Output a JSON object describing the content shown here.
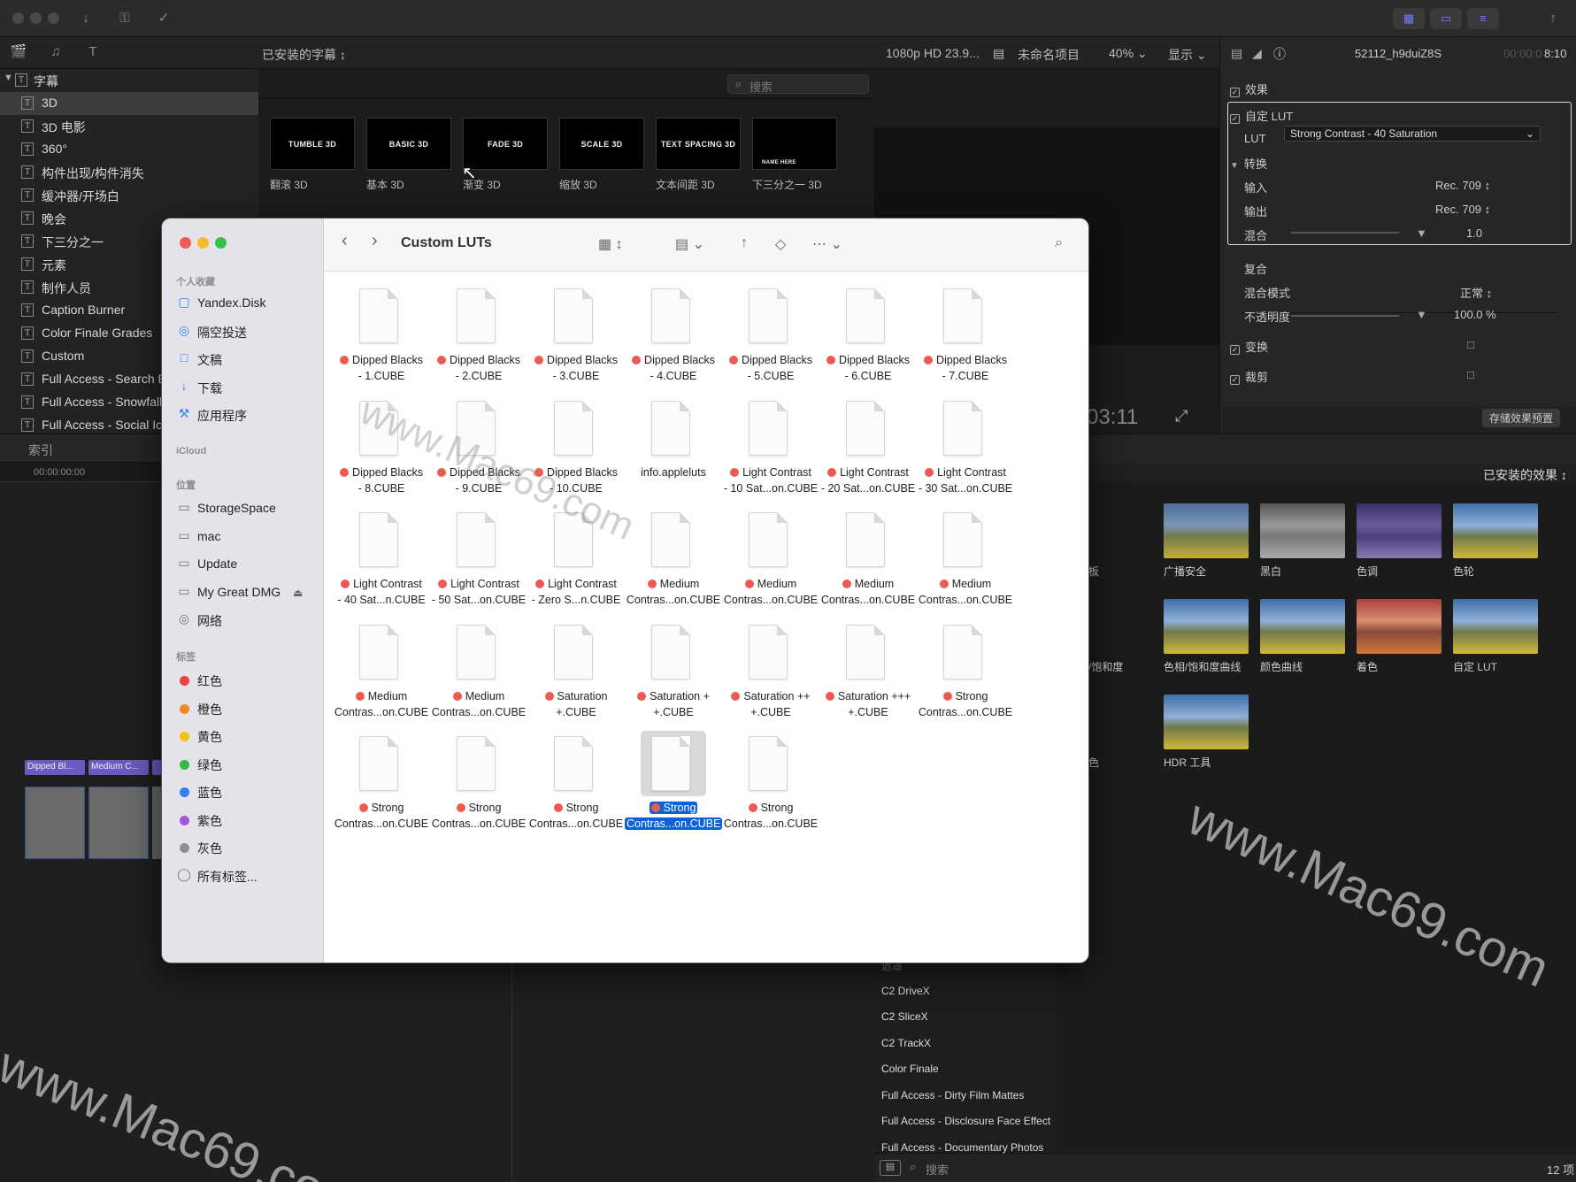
{
  "toolbar": {
    "icons": [
      "download-icon",
      "key-icon",
      "check-circle-icon"
    ]
  },
  "browser": {
    "title": "已安装的字幕",
    "search_placeholder": "搜索",
    "thumbs": [
      {
        "art": "TUMBLE 3D",
        "label": "翻滚 3D"
      },
      {
        "art": "BASIC 3D",
        "label": "基本 3D"
      },
      {
        "art": "FADE 3D",
        "label": "渐变 3D"
      },
      {
        "art": "SCALE 3D",
        "label": "缩放 3D"
      },
      {
        "art": "TEXT SPACING 3D",
        "label": "文本间距 3D"
      },
      {
        "art": "NAME HERE",
        "label": "下三分之一 3D"
      }
    ]
  },
  "viewer": {
    "format": "1080p HD 23.9...",
    "project": "未命名项目",
    "zoom": "40%",
    "display": "显示",
    "timecode": "03:11"
  },
  "sidebar": {
    "root": "字幕",
    "items": [
      "3D",
      "3D 电影",
      "360°",
      "构件出现/构件消失",
      "缓冲器/开场白",
      "晚会",
      "下三分之一",
      "元素",
      "制作人员",
      "Caption Burner",
      "Color Finale Grades",
      "Custom",
      "Full Access - Search E",
      "Full Access - Snowfall",
      "Full Access - Social Ico"
    ]
  },
  "inspector": {
    "clip_name": "52112_h9duiZ8S",
    "duration": "8:10",
    "timecode_prefix": "00:00:0",
    "effects": "效果",
    "custom_lut": "自定 LUT",
    "lut_label": "LUT",
    "lut_value": "Strong Contrast - 40 Saturation",
    "convert": "转换",
    "input_label": "输入",
    "input_value": "Rec. 709",
    "output_label": "输出",
    "output_value": "Rec. 709",
    "mix_label": "混合",
    "mix_value": "1.0",
    "composite": "复合",
    "blend_mode_label": "混合模式",
    "blend_mode_value": "正常",
    "opacity_label": "不透明度",
    "opacity_value": "100.0",
    "opacity_unit": "%",
    "transform": "变换",
    "crop": "裁剪",
    "save_preset": "存储效果预置"
  },
  "timeline": {
    "index_tab": "索引",
    "timecode": "00:00:00:00",
    "clip1": "Dipped Bl...",
    "clip2": "Medium C..."
  },
  "effects": {
    "title": "已安装的效果",
    "count": "12 项",
    "search_placeholder": "搜索",
    "row1": [
      "板",
      "广播安全",
      "黑白",
      "色调",
      "色轮"
    ],
    "row2": [
      "/饱和度",
      "色相/饱和度曲线",
      "颜色曲线",
      "着色",
      "自定 LUT"
    ],
    "row3": [
      "色",
      "HDR 工具"
    ],
    "categories": [
      "遮罩",
      "C2 DriveX",
      "C2 SliceX",
      "C2 TrackX",
      "Color Finale",
      "Full Access - Dirty Film Mattes",
      "Full Access - Disclosure Face Effect",
      "Full Access - Documentary Photos"
    ]
  },
  "finder": {
    "title": "Custom LUTs",
    "sections": {
      "favorites": "个人收藏",
      "icloud": "iCloud",
      "locations": "位置",
      "tags": "标签"
    },
    "favorites": [
      {
        "icon": "cloud-folder-icon",
        "label": "Yandex.Disk"
      },
      {
        "icon": "airdrop-icon",
        "label": "隔空投送"
      },
      {
        "icon": "document-icon",
        "label": "文稿"
      },
      {
        "icon": "download-icon",
        "label": "下载"
      },
      {
        "icon": "applications-icon",
        "label": "应用程序"
      }
    ],
    "locations": [
      {
        "icon": "disk-icon",
        "label": "StorageSpace"
      },
      {
        "icon": "disk-icon",
        "label": "mac"
      },
      {
        "icon": "disk-icon",
        "label": "Update"
      },
      {
        "icon": "disk-icon",
        "label": "My Great DMG"
      },
      {
        "icon": "network-icon",
        "label": "网络"
      }
    ],
    "tags": [
      {
        "label": "红色",
        "color": "#e8453c"
      },
      {
        "label": "橙色",
        "color": "#f08c1e"
      },
      {
        "label": "黄色",
        "color": "#f2c216"
      },
      {
        "label": "绿色",
        "color": "#33b84a"
      },
      {
        "label": "蓝色",
        "color": "#2f7ff5"
      },
      {
        "label": "紫色",
        "color": "#a257d6"
      },
      {
        "label": "灰色",
        "color": "#8e8e93"
      }
    ],
    "all_tags": "所有标签...",
    "files": [
      {
        "l1": "Dipped Blacks",
        "l2": "- 1.CUBE",
        "tag": true
      },
      {
        "l1": "Dipped Blacks",
        "l2": "- 2.CUBE",
        "tag": true
      },
      {
        "l1": "Dipped Blacks",
        "l2": "- 3.CUBE",
        "tag": true
      },
      {
        "l1": "Dipped Blacks",
        "l2": "- 4.CUBE",
        "tag": true
      },
      {
        "l1": "Dipped Blacks",
        "l2": "- 5.CUBE",
        "tag": true
      },
      {
        "l1": "Dipped Blacks",
        "l2": "- 6.CUBE",
        "tag": true
      },
      {
        "l1": "Dipped Blacks",
        "l2": "- 7.CUBE",
        "tag": true
      },
      {
        "l1": "Dipped Blacks",
        "l2": "- 8.CUBE",
        "tag": true
      },
      {
        "l1": "Dipped Blacks",
        "l2": "- 9.CUBE",
        "tag": true
      },
      {
        "l1": "Dipped Blacks",
        "l2": "- 10.CUBE",
        "tag": true
      },
      {
        "l1": "info.appleluts",
        "l2": "",
        "tag": false
      },
      {
        "l1": "Light Contrast",
        "l2": "- 10 Sat...on.CUBE",
        "tag": true
      },
      {
        "l1": "Light Contrast",
        "l2": "- 20 Sat...on.CUBE",
        "tag": true
      },
      {
        "l1": "Light Contrast",
        "l2": "- 30 Sat...on.CUBE",
        "tag": true
      },
      {
        "l1": "Light Contrast",
        "l2": "- 40 Sat...n.CUBE",
        "tag": true
      },
      {
        "l1": "Light Contrast",
        "l2": "- 50 Sat...on.CUBE",
        "tag": true
      },
      {
        "l1": "Light Contrast",
        "l2": "- Zero S...n.CUBE",
        "tag": true
      },
      {
        "l1": "Medium",
        "l2": "Contras...on.CUBE",
        "tag": true
      },
      {
        "l1": "Medium",
        "l2": "Contras...on.CUBE",
        "tag": true
      },
      {
        "l1": "Medium",
        "l2": "Contras...on.CUBE",
        "tag": true
      },
      {
        "l1": "Medium",
        "l2": "Contras...on.CUBE",
        "tag": true
      },
      {
        "l1": "Medium",
        "l2": "Contras...on.CUBE",
        "tag": true
      },
      {
        "l1": "Medium",
        "l2": "Contras...on.CUBE",
        "tag": true
      },
      {
        "l1": "Saturation",
        "l2": "+.CUBE",
        "tag": true
      },
      {
        "l1": "Saturation +",
        "l2": "+.CUBE",
        "tag": true
      },
      {
        "l1": "Saturation ++",
        "l2": "+.CUBE",
        "tag": true
      },
      {
        "l1": "Saturation +++",
        "l2": "+.CUBE",
        "tag": true
      },
      {
        "l1": "Strong",
        "l2": "Contras...on.CUBE",
        "tag": true
      },
      {
        "l1": "Strong",
        "l2": "Contras...on.CUBE",
        "tag": true
      },
      {
        "l1": "Strong",
        "l2": "Contras...on.CUBE",
        "tag": true
      },
      {
        "l1": "Strong",
        "l2": "Contras...on.CUBE",
        "tag": true
      },
      {
        "l1": "Strong",
        "l2": "Contras...on.CUBE",
        "tag": true,
        "selected": true
      },
      {
        "l1": "Strong",
        "l2": "Contras...on.CUBE",
        "tag": true
      }
    ]
  },
  "watermark": "www.Mac69.com",
  "colors": {
    "accent": "#0f61d6",
    "tag_red": "#ec5a52",
    "purple_seg": "#6f7cff"
  }
}
